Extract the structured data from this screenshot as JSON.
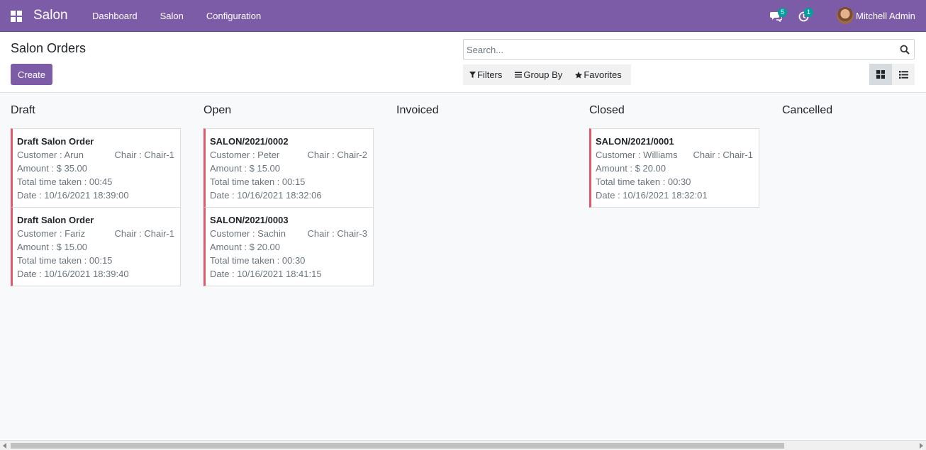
{
  "navbar": {
    "brand": "Salon",
    "menu": [
      "Dashboard",
      "Salon",
      "Configuration"
    ],
    "messages_count": "5",
    "activities_count": "1",
    "user_name": "Mitchell Admin",
    "color": "#7c5ca6"
  },
  "control_panel": {
    "title": "Salon Orders",
    "create_label": "Create",
    "search_placeholder": "Search...",
    "filters_label": "Filters",
    "group_by_label": "Group By",
    "favorites_label": "Favorites",
    "active_view": "kanban"
  },
  "kanban": {
    "columns": [
      {
        "title": "Draft",
        "cards": [
          {
            "title": "Draft Salon Order",
            "customer": "Customer : Arun",
            "chair": "Chair : Chair-1",
            "amount": "Amount : $ 35.00",
            "time": "Total time taken : 00:45",
            "date": "Date : 10/16/2021 18:39:00"
          },
          {
            "title": "Draft Salon Order",
            "customer": "Customer : Fariz",
            "chair": "Chair : Chair-1",
            "amount": "Amount : $ 15.00",
            "time": "Total time taken : 00:15",
            "date": "Date : 10/16/2021 18:39:40"
          }
        ]
      },
      {
        "title": "Open",
        "cards": [
          {
            "title": "SALON/2021/0002",
            "customer": "Customer : Peter",
            "chair": "Chair : Chair-2",
            "amount": "Amount : $ 15.00",
            "time": "Total time taken : 00:15",
            "date": "Date : 10/16/2021 18:32:06"
          },
          {
            "title": "SALON/2021/0003",
            "customer": "Customer : Sachin",
            "chair": "Chair : Chair-3",
            "amount": "Amount : $ 20.00",
            "time": "Total time taken : 00:30",
            "date": "Date : 10/16/2021 18:41:15"
          }
        ]
      },
      {
        "title": "Invoiced",
        "cards": []
      },
      {
        "title": "Closed",
        "cards": [
          {
            "title": "SALON/2021/0001",
            "customer": "Customer : Williams",
            "chair": "Chair : Chair-1",
            "amount": "Amount : $ 20.00",
            "time": "Total time taken : 00:30",
            "date": "Date : 10/16/2021 18:32:01"
          }
        ]
      },
      {
        "title": "Cancelled",
        "cards": []
      }
    ],
    "card_accent": "#e4586b"
  }
}
